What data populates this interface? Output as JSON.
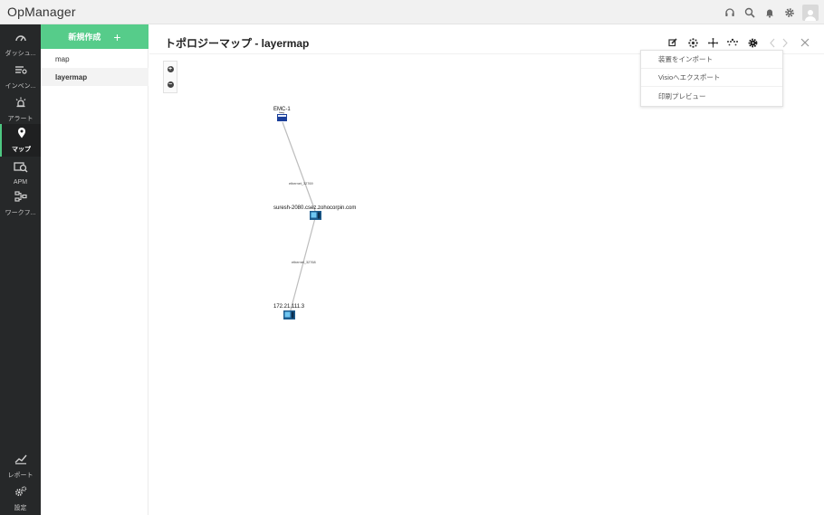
{
  "app": {
    "title": "OpManager"
  },
  "leftnav": {
    "items": [
      {
        "key": "dashboard",
        "label": "ダッシュ..."
      },
      {
        "key": "inventory",
        "label": "インベン..."
      },
      {
        "key": "alarms",
        "label": "アラート"
      },
      {
        "key": "maps",
        "label": "マップ"
      },
      {
        "key": "apm",
        "label": "APM"
      },
      {
        "key": "workflow",
        "label": "ワークフ..."
      },
      {
        "key": "reports",
        "label": "レポート"
      },
      {
        "key": "settings",
        "label": "設定"
      }
    ],
    "active": "maps"
  },
  "sidepanel": {
    "new_label": "新規作成",
    "maps": [
      "map",
      "layermap"
    ],
    "selected": "layermap"
  },
  "main": {
    "title": "トポロジーマップ - layermap",
    "menu": [
      "装置をインポート",
      "Visioへエクスポート",
      "印刷プレビュー"
    ]
  },
  "topology": {
    "nodes": [
      {
        "name": "EMC-1"
      },
      {
        "name": "suresh-2080.csez.zohocorpin.com"
      },
      {
        "name": "172.21.111.3"
      }
    ],
    "links": [
      {
        "label": "ethernet_32769"
      },
      {
        "label": "ethernet_32768"
      }
    ]
  }
}
